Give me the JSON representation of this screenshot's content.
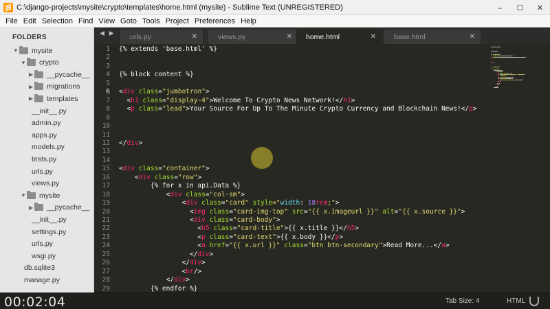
{
  "window": {
    "title": "C:\\django-projects\\mysite\\crypto\\templates\\home.html (mysite) - Sublime Text (UNREGISTERED)",
    "controls": [
      "–",
      "☐",
      "✕"
    ]
  },
  "menu": [
    "File",
    "Edit",
    "Selection",
    "Find",
    "View",
    "Goto",
    "Tools",
    "Project",
    "Preferences",
    "Help"
  ],
  "sidebar": {
    "title": "FOLDERS",
    "items": [
      {
        "label": "mysite",
        "kind": "folder",
        "open": true,
        "depth": 0
      },
      {
        "label": "crypto",
        "kind": "folder",
        "open": true,
        "depth": 1
      },
      {
        "label": "__pycache__",
        "kind": "folder",
        "open": false,
        "depth": 2
      },
      {
        "label": "migrations",
        "kind": "folder",
        "open": false,
        "depth": 2
      },
      {
        "label": "templates",
        "kind": "folder",
        "open": false,
        "depth": 2
      },
      {
        "label": "__init__.py",
        "kind": "file",
        "depth": 2
      },
      {
        "label": "admin.py",
        "kind": "file",
        "depth": 2
      },
      {
        "label": "apps.py",
        "kind": "file",
        "depth": 2
      },
      {
        "label": "models.py",
        "kind": "file",
        "depth": 2
      },
      {
        "label": "tests.py",
        "kind": "file",
        "depth": 2
      },
      {
        "label": "urls.py",
        "kind": "file",
        "depth": 2
      },
      {
        "label": "views.py",
        "kind": "file",
        "depth": 2
      },
      {
        "label": "mysite",
        "kind": "folder",
        "open": true,
        "depth": 1
      },
      {
        "label": "__pycache__",
        "kind": "folder",
        "open": false,
        "depth": 2
      },
      {
        "label": "__init__.py",
        "kind": "file",
        "depth": 2
      },
      {
        "label": "settings.py",
        "kind": "file",
        "depth": 2
      },
      {
        "label": "urls.py",
        "kind": "file",
        "depth": 2
      },
      {
        "label": "wsgi.py",
        "kind": "file",
        "depth": 2
      },
      {
        "label": "db.sqlite3",
        "kind": "file",
        "depth": 1
      },
      {
        "label": "manage.py",
        "kind": "file",
        "depth": 1
      }
    ]
  },
  "tabs": [
    {
      "label": "urls.py",
      "active": false
    },
    {
      "label": "views.py",
      "active": false
    },
    {
      "label": "home.html",
      "active": true
    },
    {
      "label": "base.html",
      "active": false
    }
  ],
  "tab_nav": "◀ ▶",
  "tab_close": "✕",
  "editor": {
    "current_line": 6,
    "colors": {
      "tag": "#f92672",
      "attr": "#a6e22e",
      "string": "#e6db74",
      "text": "#f8f8f2",
      "keyword": "#66d9ef",
      "number": "#ae81ff",
      "linenumber": "#8f908a"
    },
    "lines": [
      {
        "n": "1",
        "tokens": [
          [
            "{% extends 'base.html' %}",
            "text"
          ]
        ]
      },
      {
        "n": "2",
        "tokens": []
      },
      {
        "n": "3",
        "tokens": []
      },
      {
        "n": "4",
        "tokens": [
          [
            "{% block content %}",
            "text"
          ]
        ]
      },
      {
        "n": "5",
        "tokens": []
      },
      {
        "n": "6",
        "tokens": [
          [
            "<",
            "text"
          ],
          [
            "div",
            "tag"
          ],
          [
            " ",
            "text"
          ],
          [
            "class",
            "attr"
          ],
          [
            "=",
            "text"
          ],
          [
            "\"jumbotron\"",
            "string"
          ],
          [
            ">",
            "text"
          ]
        ]
      },
      {
        "n": "7",
        "tokens": [
          [
            "  <",
            "text"
          ],
          [
            "h1",
            "tag"
          ],
          [
            " ",
            "text"
          ],
          [
            "class",
            "attr"
          ],
          [
            "=",
            "text"
          ],
          [
            "\"display-4\"",
            "string"
          ],
          [
            ">Welcome To Crypto News Network!</",
            "text"
          ],
          [
            "h1",
            "tag"
          ],
          [
            ">",
            "text"
          ]
        ]
      },
      {
        "n": "8",
        "tokens": [
          [
            "  <",
            "text"
          ],
          [
            "p",
            "tag"
          ],
          [
            " ",
            "text"
          ],
          [
            "class",
            "attr"
          ],
          [
            "=",
            "text"
          ],
          [
            "\"lead\"",
            "string"
          ],
          [
            ">Your Source For Up To The Minute Crypto Currency and Blockchain News!</",
            "text"
          ],
          [
            "p",
            "tag"
          ],
          [
            ">",
            "text"
          ]
        ]
      },
      {
        "n": "9",
        "tokens": []
      },
      {
        "n": "10",
        "tokens": []
      },
      {
        "n": "11",
        "tokens": []
      },
      {
        "n": "12",
        "tokens": [
          [
            "</",
            "text"
          ],
          [
            "div",
            "tag"
          ],
          [
            ">",
            "text"
          ]
        ]
      },
      {
        "n": "13",
        "tokens": []
      },
      {
        "n": "14",
        "tokens": []
      },
      {
        "n": "15",
        "tokens": [
          [
            "<",
            "text"
          ],
          [
            "div",
            "tag"
          ],
          [
            " ",
            "text"
          ],
          [
            "class",
            "attr"
          ],
          [
            "=",
            "text"
          ],
          [
            "\"container\"",
            "string"
          ],
          [
            ">",
            "text"
          ]
        ]
      },
      {
        "n": "16",
        "tokens": [
          [
            "    <",
            "text"
          ],
          [
            "div",
            "tag"
          ],
          [
            " ",
            "text"
          ],
          [
            "class",
            "attr"
          ],
          [
            "=",
            "text"
          ],
          [
            "\"row\"",
            "string"
          ],
          [
            ">",
            "text"
          ]
        ]
      },
      {
        "n": "17",
        "tokens": [
          [
            "        {% for x in api.Data %}",
            "text"
          ]
        ]
      },
      {
        "n": "18",
        "tokens": [
          [
            "            <",
            "text"
          ],
          [
            "div",
            "tag"
          ],
          [
            " ",
            "text"
          ],
          [
            "class",
            "attr"
          ],
          [
            "=",
            "text"
          ],
          [
            "\"col-sm\"",
            "string"
          ],
          [
            ">",
            "text"
          ]
        ]
      },
      {
        "n": "19",
        "tokens": [
          [
            "                <",
            "text"
          ],
          [
            "div",
            "tag"
          ],
          [
            " ",
            "text"
          ],
          [
            "class",
            "attr"
          ],
          [
            "=",
            "text"
          ],
          [
            "\"card\"",
            "string"
          ],
          [
            " ",
            "text"
          ],
          [
            "style",
            "attr"
          ],
          [
            "=\"",
            "string"
          ],
          [
            "width",
            "keyword"
          ],
          [
            ": ",
            "text"
          ],
          [
            "18",
            "number"
          ],
          [
            "rem",
            "tag"
          ],
          [
            ";\"",
            "string"
          ],
          [
            ">",
            "text"
          ]
        ]
      },
      {
        "n": "20",
        "tokens": [
          [
            "                  <",
            "text"
          ],
          [
            "img",
            "tag"
          ],
          [
            " ",
            "text"
          ],
          [
            "class",
            "attr"
          ],
          [
            "=",
            "text"
          ],
          [
            "\"card-img-top\"",
            "string"
          ],
          [
            " ",
            "text"
          ],
          [
            "src",
            "attr"
          ],
          [
            "=",
            "text"
          ],
          [
            "\"{{ x.imageurl }}\"",
            "string"
          ],
          [
            " ",
            "text"
          ],
          [
            "alt",
            "attr"
          ],
          [
            "=",
            "text"
          ],
          [
            "\"{{ x.source }}\"",
            "string"
          ],
          [
            ">",
            "text"
          ]
        ]
      },
      {
        "n": "21",
        "tokens": [
          [
            "                  <",
            "text"
          ],
          [
            "div",
            "tag"
          ],
          [
            " ",
            "text"
          ],
          [
            "class",
            "attr"
          ],
          [
            "=",
            "text"
          ],
          [
            "\"card-body\"",
            "string"
          ],
          [
            ">",
            "text"
          ]
        ]
      },
      {
        "n": "22",
        "tokens": [
          [
            "                    <",
            "text"
          ],
          [
            "h5",
            "tag"
          ],
          [
            " ",
            "text"
          ],
          [
            "class",
            "attr"
          ],
          [
            "=",
            "text"
          ],
          [
            "\"card-title\"",
            "string"
          ],
          [
            ">{{ x.title }}</",
            "text"
          ],
          [
            "h5",
            "tag"
          ],
          [
            ">",
            "text"
          ]
        ]
      },
      {
        "n": "23",
        "tokens": [
          [
            "                    <",
            "text"
          ],
          [
            "p",
            "tag"
          ],
          [
            " ",
            "text"
          ],
          [
            "class",
            "attr"
          ],
          [
            "=",
            "text"
          ],
          [
            "\"card-text\"",
            "string"
          ],
          [
            ">{{ x.body }}</",
            "text"
          ],
          [
            "p",
            "tag"
          ],
          [
            ">",
            "text"
          ]
        ]
      },
      {
        "n": "24",
        "tokens": [
          [
            "                    <",
            "text"
          ],
          [
            "a",
            "tag"
          ],
          [
            " ",
            "text"
          ],
          [
            "href",
            "attr"
          ],
          [
            "=",
            "text"
          ],
          [
            "\"{{ x.url }}\"",
            "string"
          ],
          [
            " ",
            "text"
          ],
          [
            "class",
            "attr"
          ],
          [
            "=",
            "text"
          ],
          [
            "\"btn btn-secondary\"",
            "string"
          ],
          [
            ">Read More...</",
            "text"
          ],
          [
            "a",
            "tag"
          ],
          [
            ">",
            "text"
          ]
        ]
      },
      {
        "n": "25",
        "tokens": [
          [
            "                  </",
            "text"
          ],
          [
            "div",
            "tag"
          ],
          [
            ">",
            "text"
          ]
        ]
      },
      {
        "n": "26",
        "tokens": [
          [
            "                </",
            "text"
          ],
          [
            "div",
            "tag"
          ],
          [
            ">",
            "text"
          ]
        ]
      },
      {
        "n": "27",
        "tokens": [
          [
            "                <",
            "text"
          ],
          [
            "br",
            "tag"
          ],
          [
            "/>",
            "text"
          ]
        ]
      },
      {
        "n": "28",
        "tokens": [
          [
            "            </",
            "text"
          ],
          [
            "div",
            "tag"
          ],
          [
            ">",
            "text"
          ]
        ]
      },
      {
        "n": "29",
        "tokens": [
          [
            "        {% endfor %}",
            "text"
          ]
        ]
      }
    ]
  },
  "status": {
    "timer": "00:02:04",
    "tab_size": "Tab Size: 4",
    "syntax": "HTML"
  }
}
